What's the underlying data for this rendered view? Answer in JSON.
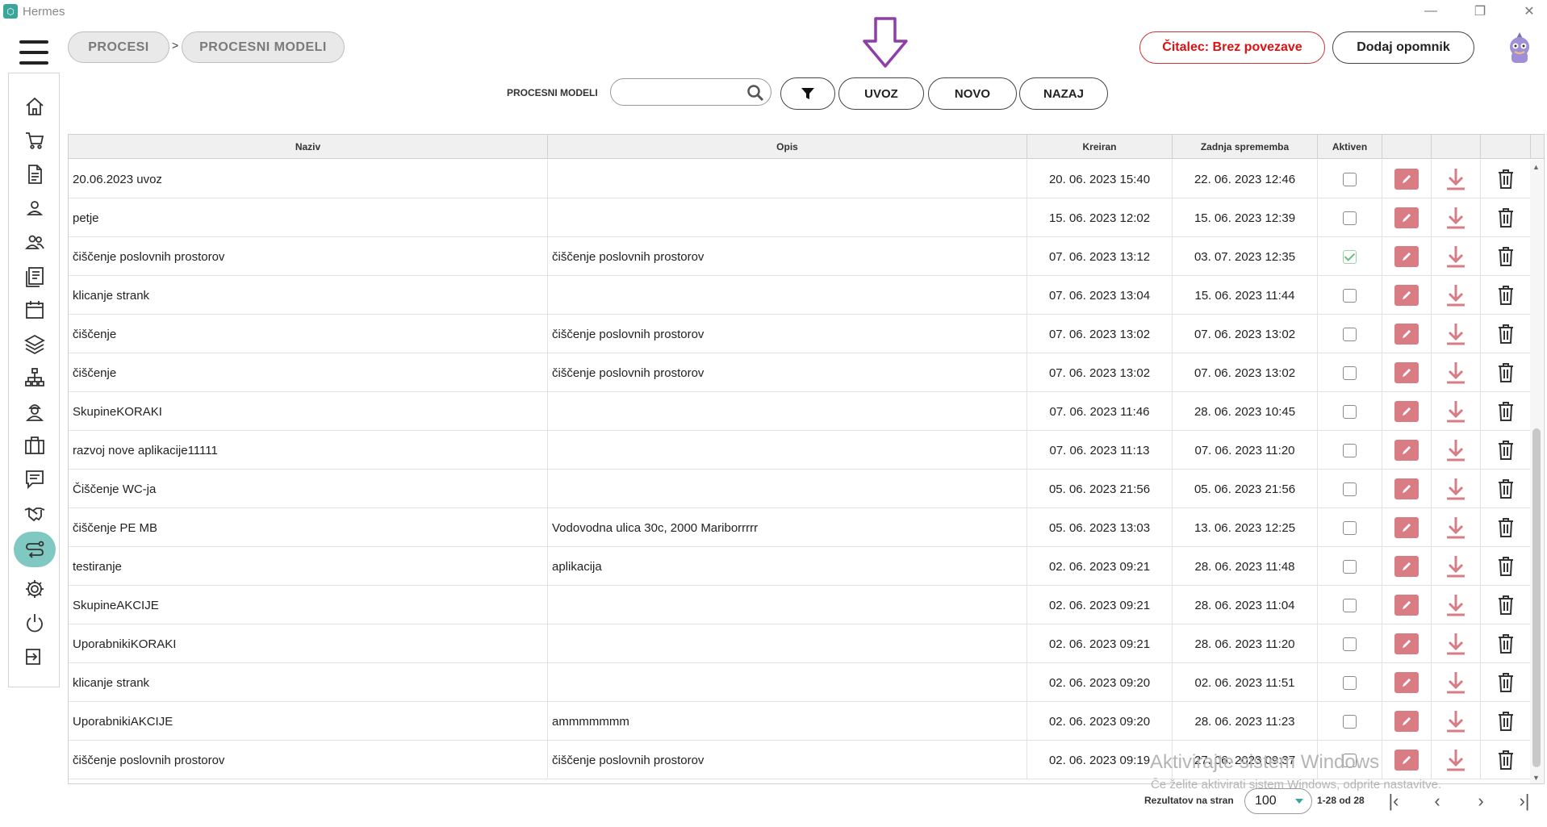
{
  "app": {
    "title": "Hermes"
  },
  "breadcrumb": {
    "items": [
      "PROCESI",
      "PROCESNI MODELI"
    ],
    "separator": ">"
  },
  "top_actions": {
    "reader_status": "Čitalec: Brez povezave",
    "add_reminder": "Dodaj opomnik"
  },
  "toolbar": {
    "label": "PROCESNI MODELI",
    "search_value": "",
    "import_label": "UVOZ",
    "new_label": "NOVO",
    "back_label": "NAZAJ"
  },
  "colors": {
    "accent": "#7fc9c2",
    "edit": "#d97c83",
    "reader_alert": "#dd1111",
    "annotation_arrow": "#8e3ea6"
  },
  "sidebar": {
    "icons": [
      "home-icon",
      "cart-icon",
      "document-icon",
      "person-icon",
      "people-icon",
      "list-icon",
      "calendar-icon",
      "layers-icon",
      "hierarchy-icon",
      "worker-icon",
      "briefcase-icon",
      "chat-icon",
      "handshake-icon",
      "process-icon",
      "gear-icon",
      "power-icon",
      "logout-icon"
    ],
    "active": "process-icon"
  },
  "table": {
    "columns": [
      "Naziv",
      "Opis",
      "Kreiran",
      "Zadnja sprememba",
      "Aktiven",
      "",
      "",
      ""
    ],
    "rows": [
      {
        "naziv": "20.06.2023 uvoz",
        "opis": "",
        "kreiran": "20. 06. 2023 15:40",
        "sprememba": "22. 06. 2023 12:46",
        "aktiven": false
      },
      {
        "naziv": "petje",
        "opis": "",
        "kreiran": "15. 06. 2023 12:02",
        "sprememba": "15. 06. 2023 12:39",
        "aktiven": false
      },
      {
        "naziv": "čiščenje poslovnih prostorov",
        "opis": "čiščenje poslovnih prostorov",
        "kreiran": "07. 06. 2023 13:12",
        "sprememba": "03. 07. 2023 12:35",
        "aktiven": true
      },
      {
        "naziv": "klicanje strank",
        "opis": "",
        "kreiran": "07. 06. 2023 13:04",
        "sprememba": "15. 06. 2023 11:44",
        "aktiven": false
      },
      {
        "naziv": "čiščenje",
        "opis": "čiščenje poslovnih prostorov",
        "kreiran": "07. 06. 2023 13:02",
        "sprememba": "07. 06. 2023 13:02",
        "aktiven": false
      },
      {
        "naziv": "čiščenje",
        "opis": "čiščenje poslovnih prostorov",
        "kreiran": "07. 06. 2023 13:02",
        "sprememba": "07. 06. 2023 13:02",
        "aktiven": false
      },
      {
        "naziv": "SkupineKORAKI",
        "opis": "",
        "kreiran": "07. 06. 2023 11:46",
        "sprememba": "28. 06. 2023 10:45",
        "aktiven": false
      },
      {
        "naziv": "razvoj nove aplikacije11111",
        "opis": "",
        "kreiran": "07. 06. 2023 11:13",
        "sprememba": "07. 06. 2023 11:20",
        "aktiven": false
      },
      {
        "naziv": "Čiščenje WC-ja",
        "opis": "",
        "kreiran": "05. 06. 2023 21:56",
        "sprememba": "05. 06. 2023 21:56",
        "aktiven": false
      },
      {
        "naziv": "čiščenje PE MB",
        "opis": "Vodovodna ulica 30c, 2000 Mariborrrrr",
        "kreiran": "05. 06. 2023 13:03",
        "sprememba": "13. 06. 2023 12:25",
        "aktiven": false
      },
      {
        "naziv": "testiranje",
        "opis": "aplikacija",
        "kreiran": "02. 06. 2023 09:21",
        "sprememba": "28. 06. 2023 11:48",
        "aktiven": false
      },
      {
        "naziv": "SkupineAKCIJE",
        "opis": "",
        "kreiran": "02. 06. 2023 09:21",
        "sprememba": "28. 06. 2023 11:04",
        "aktiven": false
      },
      {
        "naziv": "UporabnikiKORAKI",
        "opis": "",
        "kreiran": "02. 06. 2023 09:21",
        "sprememba": "28. 06. 2023 11:20",
        "aktiven": false
      },
      {
        "naziv": "klicanje strank",
        "opis": "",
        "kreiran": "02. 06. 2023 09:20",
        "sprememba": "02. 06. 2023 11:51",
        "aktiven": false
      },
      {
        "naziv": "UporabnikiAKCIJE",
        "opis": "ammmmmmm",
        "kreiran": "02. 06. 2023 09:20",
        "sprememba": "28. 06. 2023 11:23",
        "aktiven": false
      },
      {
        "naziv": "čiščenje poslovnih prostorov",
        "opis": "čiščenje poslovnih prostorov",
        "kreiran": "02. 06. 2023 09:19",
        "sprememba": "27. 06. 2023 09:37",
        "aktiven": false
      }
    ]
  },
  "pager": {
    "label": "Rezultatov na stran",
    "page_size": "100",
    "range": "1-28 od 28"
  },
  "watermark": {
    "line1": "Aktivirajte sistem Windows",
    "line2": "Če želite aktivirati sistem Windows, odprite nastavitve."
  }
}
